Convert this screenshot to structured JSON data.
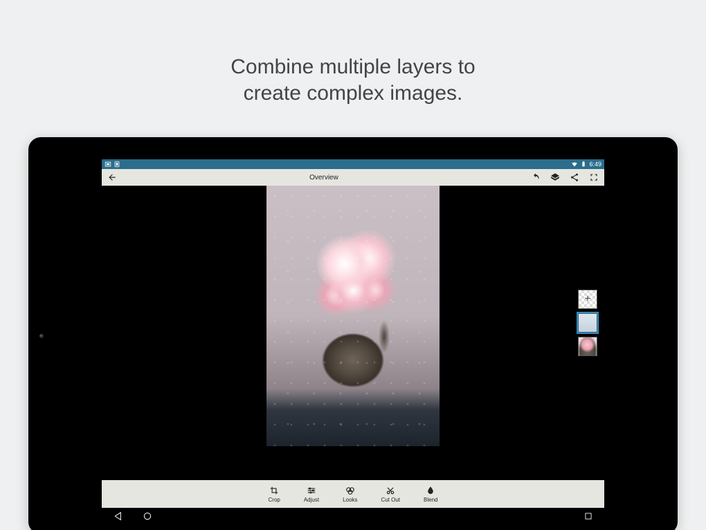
{
  "headline": {
    "line1": "Combine multiple layers to",
    "line2": "create complex images."
  },
  "statusbar": {
    "time": "6:49"
  },
  "appbar": {
    "title": "Overview"
  },
  "toolbar": {
    "crop": "Crop",
    "adjust": "Adjust",
    "looks": "Looks",
    "cutout": "Cut Out",
    "blend": "Blend"
  },
  "layers": {
    "add_label": "+",
    "selected_index": 1
  }
}
